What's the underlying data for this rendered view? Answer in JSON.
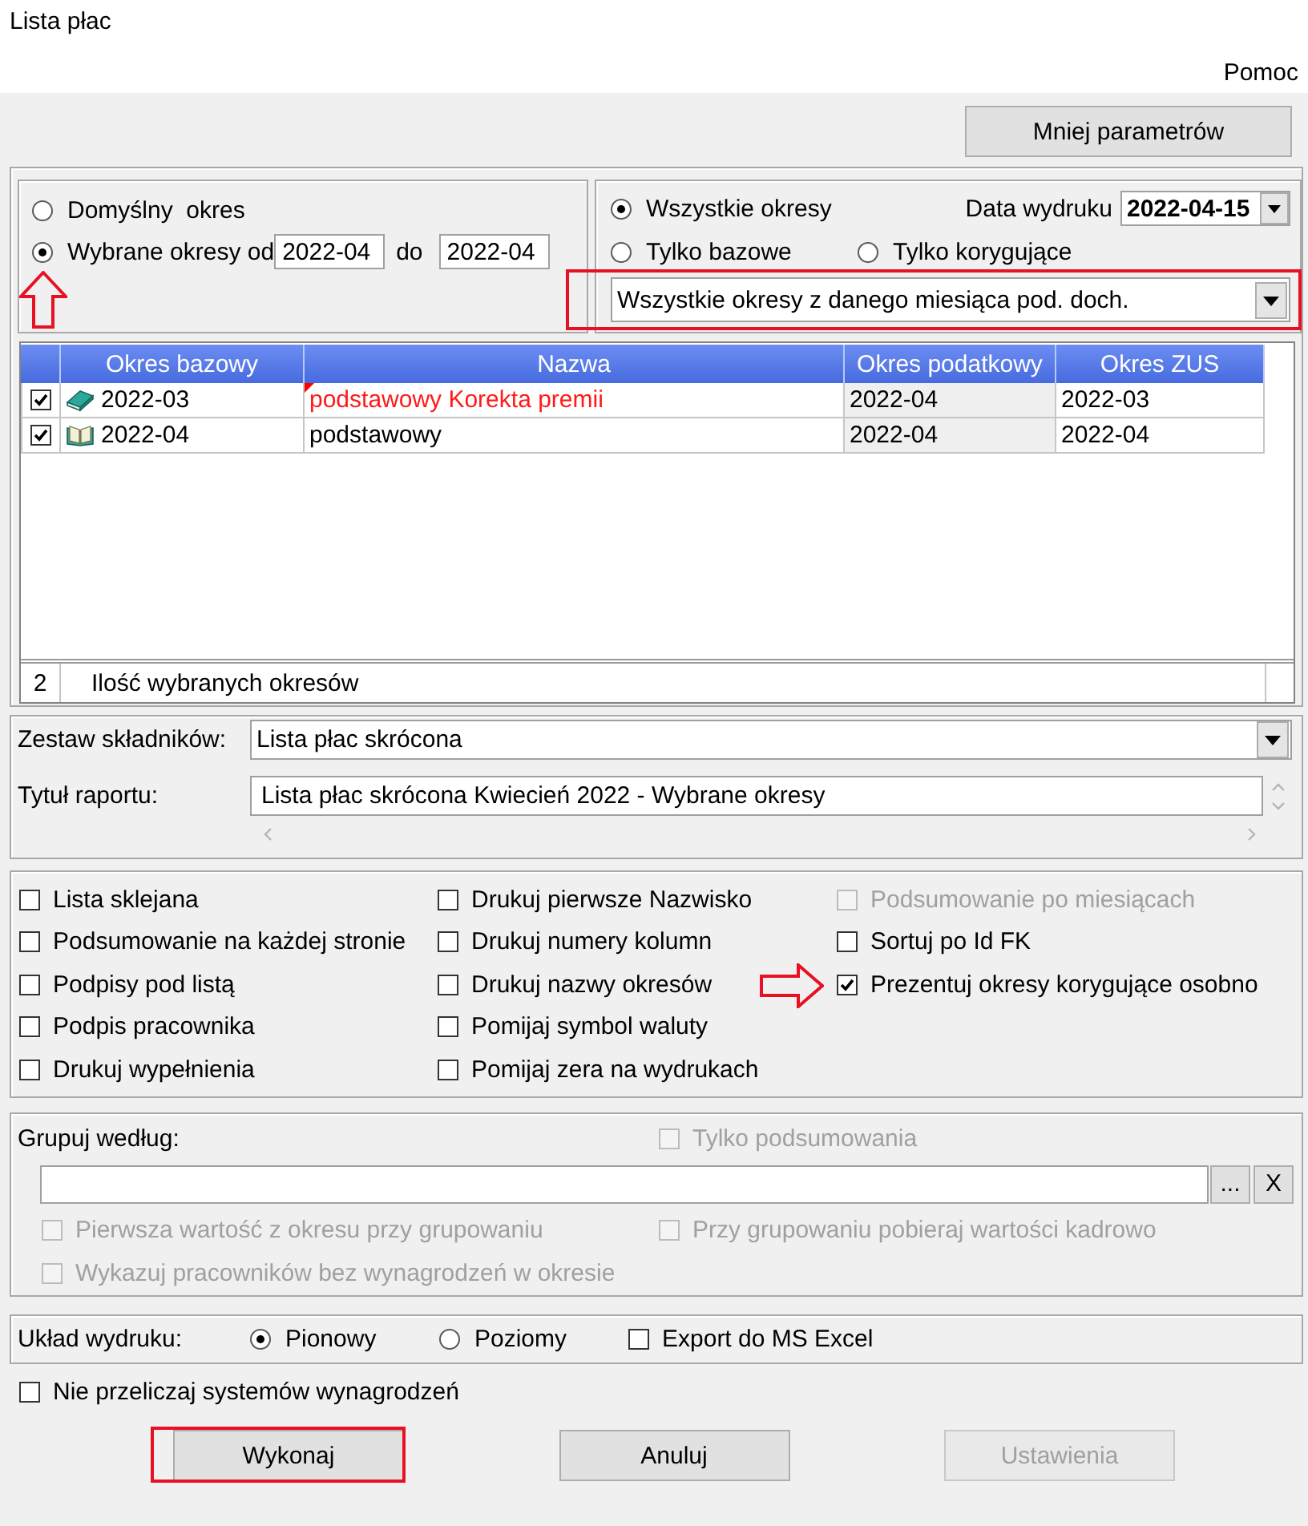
{
  "window": {
    "title": "Lista płac"
  },
  "menu": [
    {
      "label": "Pomoc"
    }
  ],
  "toolbar": {
    "toggle_button": "Mniej parametrów"
  },
  "period_range": {
    "options": [
      {
        "kind": "plain",
        "label": "Domyślny  okres",
        "selected": false,
        "marked": false
      },
      {
        "kind": "range",
        "label": "Wybrane okresy od",
        "selected": true,
        "marked": true,
        "from": "2022-04",
        "to_label": "do",
        "to": "2022-04"
      }
    ]
  },
  "period_filter": {
    "options": [
      {
        "label": "Wszystkie okresy",
        "selected": true
      },
      {
        "label": "Tylko bazowe",
        "selected": false
      },
      {
        "label": "Tylko korygujące",
        "selected": false
      }
    ],
    "print_date": {
      "label": "Data wydruku",
      "value": "2022-04-15"
    },
    "scope": {
      "value": "Wszystkie okresy z danego miesiąca pod. doch.",
      "highlighted": true
    }
  },
  "periods_table": {
    "columns": [
      "Okres bazowy",
      "Nazwa",
      "Okres podatkowy",
      "Okres ZUS"
    ],
    "rows": [
      {
        "kind": "correction",
        "checked": true,
        "base_period": "2022-03",
        "name": "podstawowy Korekta premii",
        "tax_period": "2022-04",
        "zus_period": "2022-03"
      },
      {
        "kind": "base",
        "checked": true,
        "base_period": "2022-04",
        "name": "podstawowy",
        "tax_period": "2022-04",
        "zus_period": "2022-04"
      }
    ],
    "footer": {
      "count": "2",
      "label": "Ilość wybranych okresów"
    }
  },
  "component_set": {
    "label": "Zestaw składników:",
    "value": "Lista płac skrócona"
  },
  "report_title": {
    "label": "Tytuł raportu:",
    "value": "Lista płac skrócona Kwiecień 2022 - Wybrane okresy"
  },
  "print_options": [
    [
      {
        "label": "Lista sklejana",
        "checked": false,
        "disabled": false,
        "marked": false
      },
      {
        "label": "Podsumowanie na każdej stronie",
        "checked": false,
        "disabled": false,
        "marked": false
      },
      {
        "label": "Podpisy pod listą",
        "checked": false,
        "disabled": false,
        "marked": false
      },
      {
        "label": "Podpis pracownika",
        "checked": false,
        "disabled": false,
        "marked": false
      },
      {
        "label": "Drukuj wypełnienia",
        "checked": false,
        "disabled": false,
        "marked": false
      }
    ],
    [
      {
        "label": "Drukuj pierwsze Nazwisko",
        "checked": false,
        "disabled": false,
        "marked": false
      },
      {
        "label": "Drukuj numery kolumn",
        "checked": false,
        "disabled": false,
        "marked": false
      },
      {
        "label": "Drukuj nazwy okresów",
        "checked": false,
        "disabled": false,
        "marked": false
      },
      {
        "label": "Pomijaj symbol waluty",
        "checked": false,
        "disabled": false,
        "marked": false
      },
      {
        "label": "Pomijaj zera na wydrukach",
        "checked": false,
        "disabled": false,
        "marked": false
      }
    ],
    [
      {
        "label": "Podsumowanie po miesiącach",
        "checked": false,
        "disabled": true,
        "marked": false
      },
      {
        "label": "Sortuj po Id FK",
        "checked": false,
        "disabled": false,
        "marked": false
      },
      {
        "label": "Prezentuj okresy korygujące osobno",
        "checked": true,
        "disabled": false,
        "marked": true
      }
    ]
  ],
  "grouping": {
    "label": "Grupuj według:",
    "summary_only": {
      "label": "Tylko podsumowania",
      "checked": false,
      "disabled": true
    },
    "buttons": [
      "...",
      "X"
    ],
    "options": [
      {
        "label": "Pierwsza wartość z okresu przy grupowaniu",
        "checked": false,
        "disabled": true
      },
      {
        "label": "Przy grupowaniu pobieraj wartości kadrowo",
        "checked": false,
        "disabled": true
      },
      {
        "label": "Wykazuj pracowników bez wynagrodzeń w okresie",
        "checked": false,
        "disabled": true
      }
    ]
  },
  "layout": {
    "label": "Układ wydruku:",
    "options": [
      {
        "label": "Pionowy",
        "selected": true
      },
      {
        "label": "Poziomy",
        "selected": false
      }
    ],
    "export": {
      "label": "Export do MS Excel",
      "checked": false
    }
  },
  "recalc": {
    "label": "Nie przeliczaj systemów wynagrodzeń",
    "checked": false
  },
  "buttons": [
    {
      "label": "Wykonaj",
      "disabled": false,
      "highlighted": true
    },
    {
      "label": "Anuluj",
      "disabled": false,
      "highlighted": false
    },
    {
      "label": "Ustawienia",
      "disabled": true,
      "highlighted": false
    }
  ]
}
